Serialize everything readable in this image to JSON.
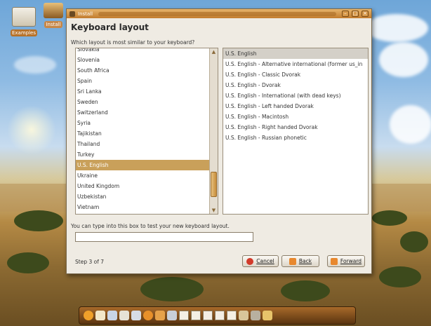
{
  "desktop": {
    "icons": [
      {
        "label": "Examples"
      },
      {
        "label": "Install"
      }
    ]
  },
  "window": {
    "title": "Install",
    "heading": "Keyboard layout",
    "prompt": "Which layout is most similar to your keyboard?",
    "countries": [
      "Slovakia",
      "Slovenia",
      "South Africa",
      "Spain",
      "Sri Lanka",
      "Sweden",
      "Switzerland",
      "Syria",
      "Tajikistan",
      "Thailand",
      "Turkey",
      "U.S. English",
      "Ukraine",
      "United Kingdom",
      "Uzbekistan",
      "Vietnam"
    ],
    "selected_country_index": 11,
    "variants": [
      "U.S. English",
      "U.S. English - Alternative international (former us_in",
      "U.S. English - Classic Dvorak",
      "U.S. English - Dvorak",
      "U.S. English - International (with dead keys)",
      "U.S. English - Left handed Dvorak",
      "U.S. English - Macintosh",
      "U.S. English - Right handed Dvorak",
      "U.S. English - Russian phonetic"
    ],
    "selected_variant_index": 0,
    "test_label": "You can type into this box to test your new keyboard layout.",
    "test_value": "",
    "step": "Step 3 of 7",
    "buttons": {
      "cancel": "Cancel",
      "back": "Back",
      "forward": "Forward"
    }
  },
  "colors": {
    "selection": "#c9a05a",
    "titlebar": "#c27c2e",
    "window_bg": "#efebe3"
  }
}
